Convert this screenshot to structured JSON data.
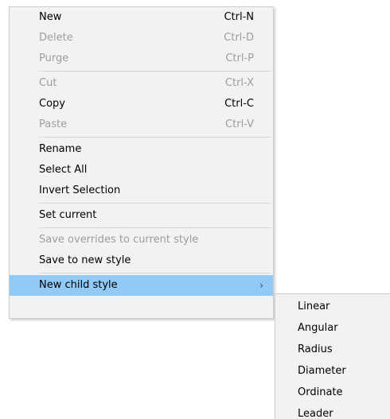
{
  "context_menu": {
    "groups": [
      [
        {
          "label": "New",
          "shortcut": "Ctrl-N",
          "enabled": true
        },
        {
          "label": "Delete",
          "shortcut": "Ctrl-D",
          "enabled": false
        },
        {
          "label": "Purge",
          "shortcut": "Ctrl-P",
          "enabled": false
        }
      ],
      [
        {
          "label": "Cut",
          "shortcut": "Ctrl-X",
          "enabled": false
        },
        {
          "label": "Copy",
          "shortcut": "Ctrl-C",
          "enabled": true
        },
        {
          "label": "Paste",
          "shortcut": "Ctrl-V",
          "enabled": false
        }
      ],
      [
        {
          "label": "Rename",
          "enabled": true
        },
        {
          "label": "Select All",
          "enabled": true
        },
        {
          "label": "Invert Selection",
          "enabled": true
        }
      ],
      [
        {
          "label": "Set current",
          "enabled": true
        }
      ],
      [
        {
          "label": "Save overrides to current style",
          "enabled": false
        },
        {
          "label": "Save to new style",
          "enabled": true
        }
      ]
    ],
    "submenu_item": {
      "label": "New child style",
      "arrow": "›",
      "highlighted": true
    }
  },
  "submenu": {
    "items": [
      "Linear",
      "Angular",
      "Radius",
      "Diameter",
      "Ordinate",
      "Leader"
    ]
  },
  "colors": {
    "menu_background": "#f2f2f2",
    "highlight": "#91c9f7",
    "disabled_text": "#9d9d9d",
    "separator": "#d7d7d7"
  }
}
